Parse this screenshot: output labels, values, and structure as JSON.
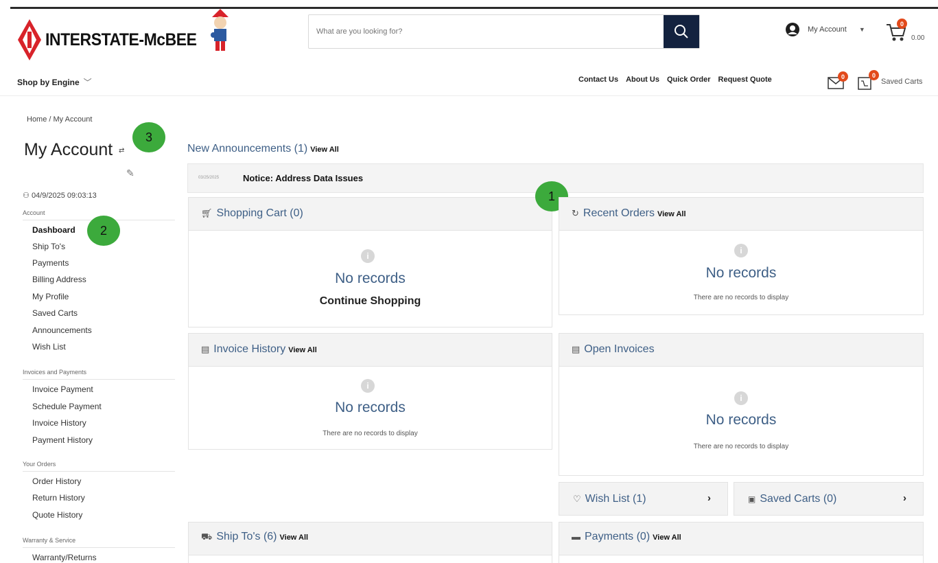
{
  "header": {
    "brand": "INTERSTATE-McBEE",
    "search_placeholder": "What are you looking for?",
    "account_label": "My Account",
    "cart_count": "0",
    "cart_total": "0.00"
  },
  "nav": {
    "shop_by_engine": "Shop by Engine",
    "links": [
      "Contact Us",
      "About Us",
      "Quick Order",
      "Request Quote"
    ],
    "mail_count": "0",
    "saved_count": "0",
    "saved_carts_label": "Saved Carts"
  },
  "sidebar": {
    "breadcrumb": "Home /  My Account",
    "title": "My Account",
    "session": "04/9/2025 09:03:13",
    "sections": [
      {
        "label": "Account",
        "items": [
          "Dashboard",
          "Ship To's",
          "Payments",
          "Billing Address",
          "My Profile",
          "Saved Carts",
          "Announcements",
          "Wish List"
        ]
      },
      {
        "label": "Invoices and Payments",
        "items": [
          "Invoice Payment",
          "Schedule Payment",
          "Invoice History",
          "Payment History"
        ]
      },
      {
        "label": "Your Orders",
        "items": [
          "Order History",
          "Return History",
          "Quote History"
        ]
      },
      {
        "label": "Warranty & Service",
        "items": [
          "Warranty/Returns"
        ]
      }
    ]
  },
  "callouts": [
    "1",
    "2",
    "3"
  ],
  "main": {
    "announcements_title": "New Announcements (1)",
    "view_all": "View All",
    "notice_date": "03/25/2025",
    "notice_text": "Notice: Address Data Issues",
    "shopping_cart": {
      "title": "Shopping Cart (0)",
      "empty": "No records",
      "cta": "Continue Shopping"
    },
    "recent_orders": {
      "title": "Recent Orders",
      "empty": "No records",
      "sub": "There are no records to display"
    },
    "invoice_history": {
      "title": "Invoice History",
      "empty": "No records",
      "sub": "There are no records to display"
    },
    "open_invoices": {
      "title": "Open Invoices",
      "empty": "No records",
      "sub": "There are no records to display"
    },
    "wish_list": "Wish List (1)",
    "saved_carts": "Saved Carts (0)",
    "ship_tos": "Ship To's (6)",
    "payments": "Payments (0)"
  },
  "colors": {
    "accent": "#3e5f86",
    "navy": "#13223f",
    "badge": "#e24a1b",
    "callout": "#3caa3c",
    "brand_red": "#d8232a"
  }
}
